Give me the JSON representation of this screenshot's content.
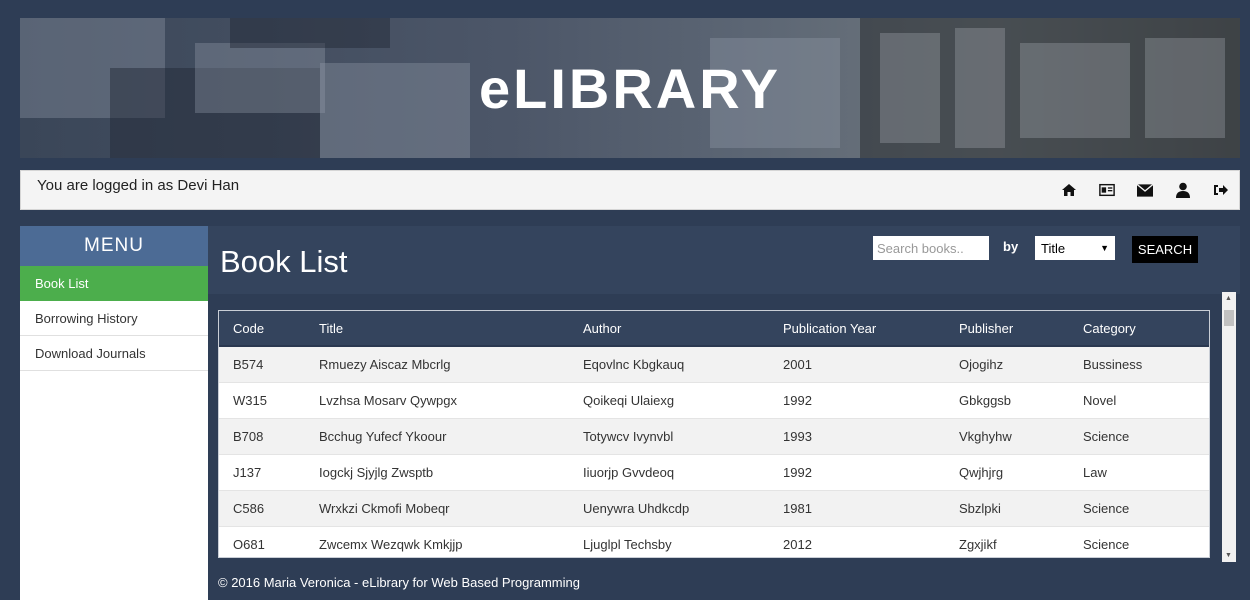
{
  "banner": {
    "title": "eLIBRARY"
  },
  "userbar": {
    "logged_in_text": "You are logged in as Devi Han",
    "icons": [
      "home-icon",
      "id-card-icon",
      "envelope-icon",
      "user-icon",
      "sign-out-icon"
    ]
  },
  "sidebar": {
    "menu_title": "MENU",
    "items": [
      {
        "label": "Book List",
        "active": true
      },
      {
        "label": "Borrowing History",
        "active": false
      },
      {
        "label": "Download Journals",
        "active": false
      }
    ]
  },
  "main": {
    "title": "Book List",
    "search": {
      "placeholder": "Search books..",
      "value": ""
    },
    "by_label": "by",
    "by_select": {
      "selected": "Title"
    },
    "search_button": "SEARCH"
  },
  "table": {
    "columns": [
      "Code",
      "Title",
      "Author",
      "Publication Year",
      "Publisher",
      "Category"
    ],
    "rows": [
      [
        "B574",
        "Rmuezy Aiscaz Mbcrlg",
        "Eqovlnc Kbgkauq",
        "2001",
        "Ojogihz",
        "Bussiness"
      ],
      [
        "W315",
        "Lvzhsa Mosarv Qywpgx",
        "Qoikeqi Ulaiexg",
        "1992",
        "Gbkggsb",
        "Novel"
      ],
      [
        "B708",
        "Bcchug Yufecf Ykoour",
        "Totywcv Ivynvbl",
        "1993",
        "Vkghyhw",
        "Science"
      ],
      [
        "J137",
        "Iogckj Sjyjlg Zwsptb",
        "Iiuorjp Gvvdeoq",
        "1992",
        "Qwjhjrg",
        "Law"
      ],
      [
        "C586",
        "Wrxkzi Ckmofi Mobeqr",
        "Uenywra Uhdkcdp",
        "1981",
        "Sbzlpki",
        "Science"
      ],
      [
        "O681",
        "Zwcemx Wezqwk Kmkjjp",
        "Ljuglpl Techsby",
        "2012",
        "Zgxjikf",
        "Science"
      ]
    ]
  },
  "footer": {
    "text": "© 2016 Maria Veronica - eLibrary for Web Based Programming"
  },
  "colors": {
    "page_bg": "#2e3d55",
    "menu_header": "#4c6b95",
    "active_menu": "#4cae4c",
    "table_header": "#34445d"
  }
}
